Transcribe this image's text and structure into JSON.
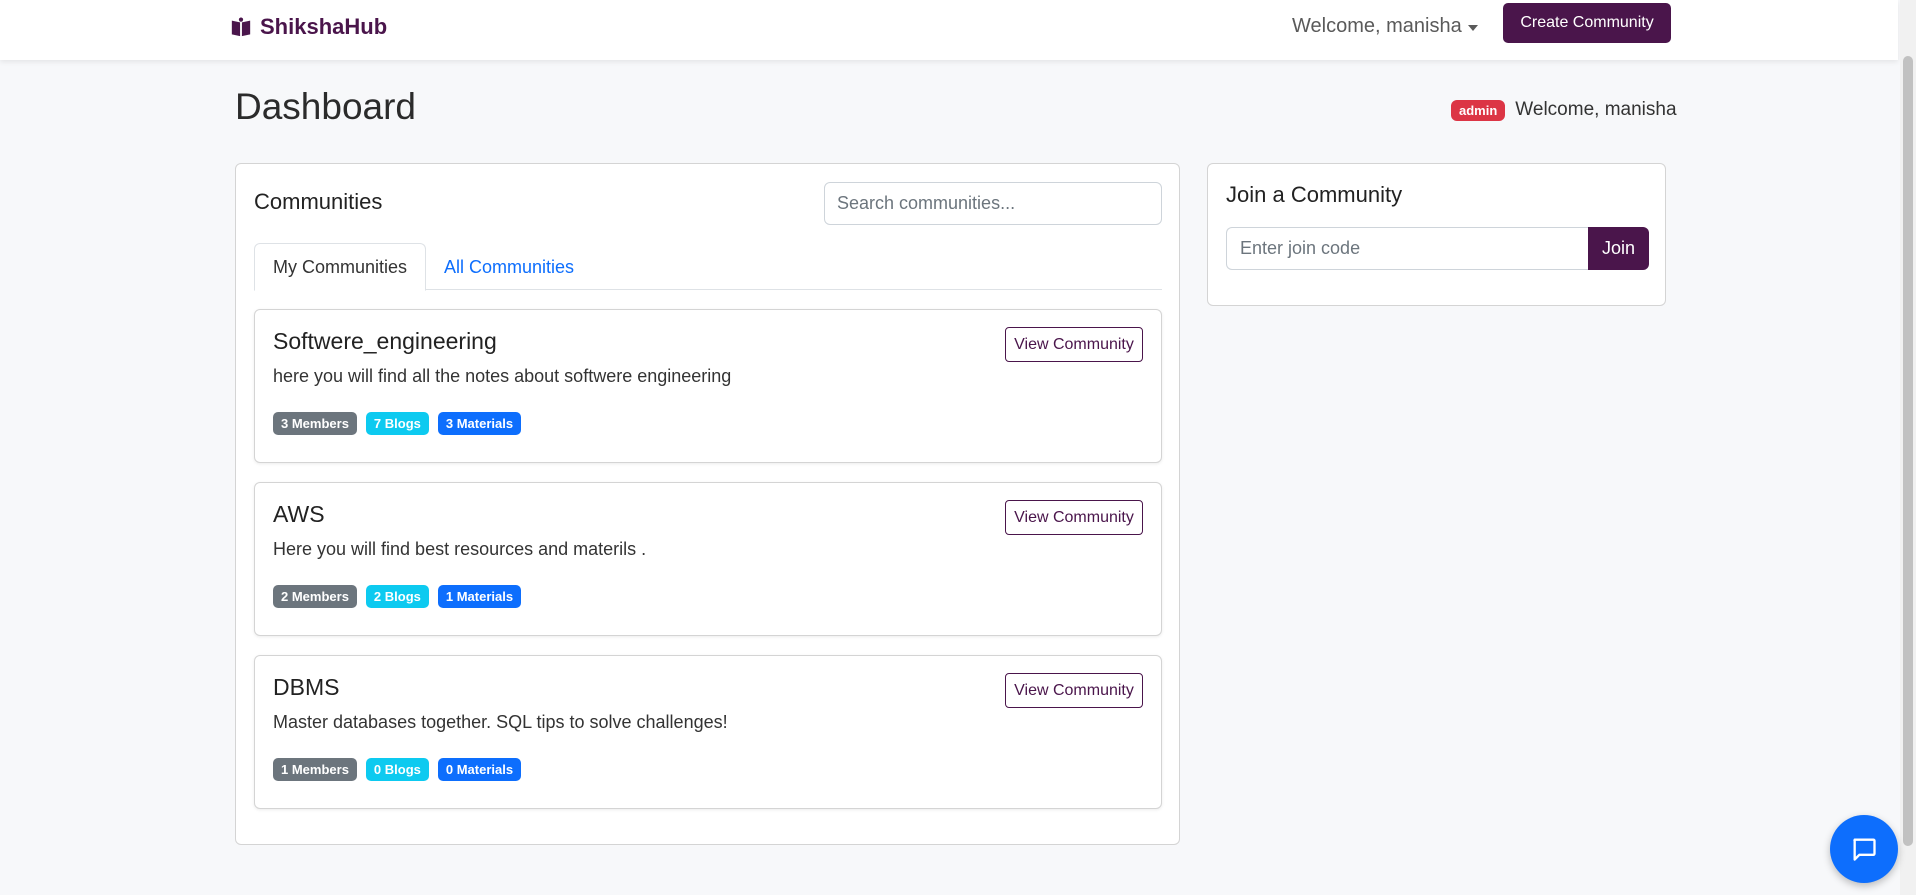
{
  "navbar": {
    "brand": "ShikshaHub",
    "brand_icon": "book-icon",
    "welcome": "Welcome, manisha",
    "create_button": "Create Community"
  },
  "header": {
    "title": "Dashboard",
    "role_badge": "admin",
    "welcome": "Welcome, manisha"
  },
  "communities": {
    "heading": "Communities",
    "search_placeholder": "Search communities...",
    "tabs": [
      {
        "label": "My Communities",
        "active": true
      },
      {
        "label": "All Communities",
        "active": false
      }
    ],
    "items": [
      {
        "name": "Softwere_engineering",
        "description": "here you will find all the notes about softwere engineering",
        "members": "3 Members",
        "blogs": "7 Blogs",
        "materials": "3 Materials",
        "action": "View Community"
      },
      {
        "name": "AWS",
        "description": "Here you will find best resources and materils .",
        "members": "2 Members",
        "blogs": "2 Blogs",
        "materials": "1 Materials",
        "action": "View Community"
      },
      {
        "name": "DBMS",
        "description": "Master databases together. SQL tips to solve challenges!",
        "members": "1 Members",
        "blogs": "0 Blogs",
        "materials": "0 Materials",
        "action": "View Community"
      }
    ]
  },
  "join": {
    "heading": "Join a Community",
    "placeholder": "Enter join code",
    "button": "Join"
  },
  "chat": {
    "icon": "chat-icon"
  },
  "colors": {
    "brand": "#4a154b",
    "primary": "#0d6efd",
    "danger": "#dc3545",
    "info": "#0dcaf0",
    "secondary": "#6c757d"
  }
}
